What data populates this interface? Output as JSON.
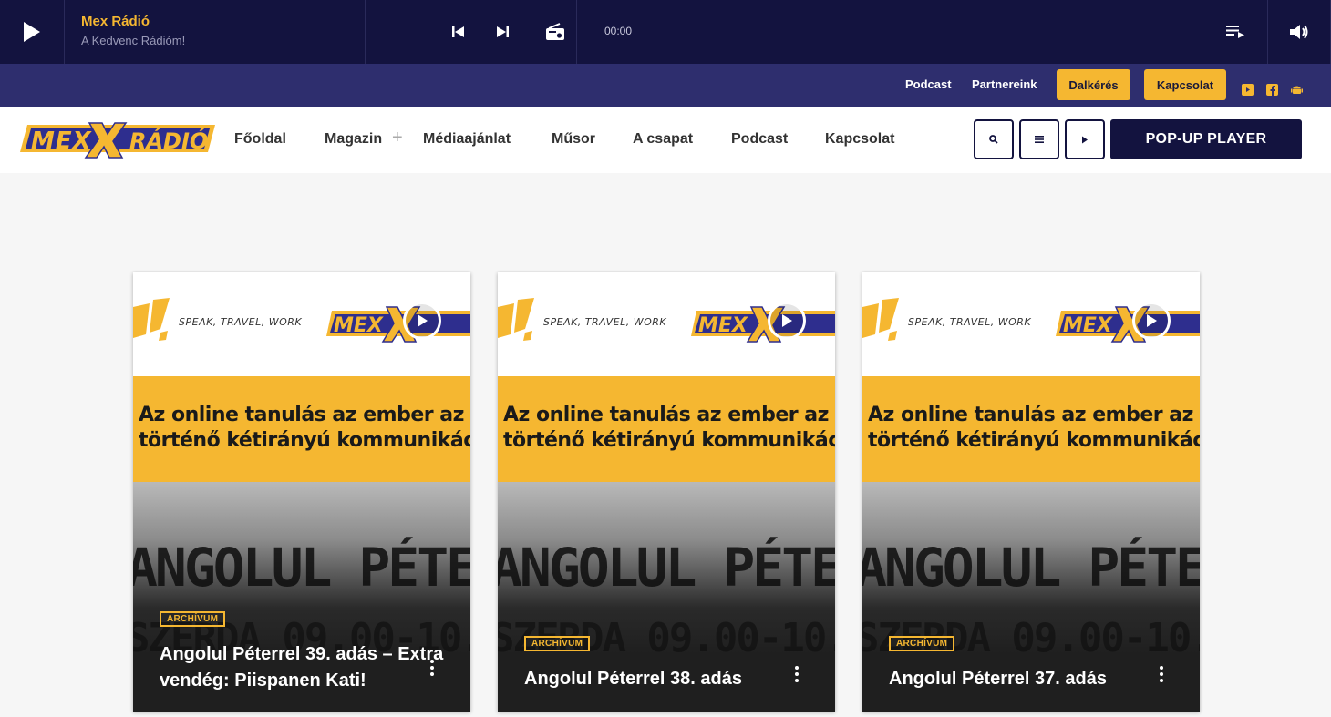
{
  "player": {
    "station_name": "Mex Rádió",
    "station_slogan": "A Kedvenc Rádióm!",
    "time": "00:00",
    "icons": [
      "play-icon",
      "previous-icon",
      "next-icon",
      "radio-icon",
      "playlist-icon",
      "volume-icon"
    ]
  },
  "topbar": {
    "links": [
      "Podcast",
      "Partnereink"
    ],
    "buttons": [
      "Dalkérés",
      "Kapcsolat"
    ],
    "social": [
      "youtube-icon",
      "facebook-icon",
      "android-icon"
    ]
  },
  "nav": {
    "logo_text": "MEX RÁDIÓ",
    "items": [
      "Főoldal",
      "Magazin",
      "Médiaajánlat",
      "Műsor",
      "A csapat",
      "Podcast",
      "Kapcsolat"
    ],
    "popup_label": "POP-UP PLAYER"
  },
  "colors": {
    "navy": "#13133f",
    "purple": "#2e2e6e",
    "accent": "#f5b731"
  },
  "cards": [
    {
      "tag": "ARCHÍVUM",
      "title": "Angolul Péterrel 39. adás – Extra vendég: Piispanen Kati!"
    },
    {
      "tag": "ARCHÍVUM",
      "title": "Angolul Péterrel 38. adás"
    },
    {
      "tag": "ARCHÍVUM",
      "title": "Angolul Péterrel 37. adás"
    }
  ]
}
